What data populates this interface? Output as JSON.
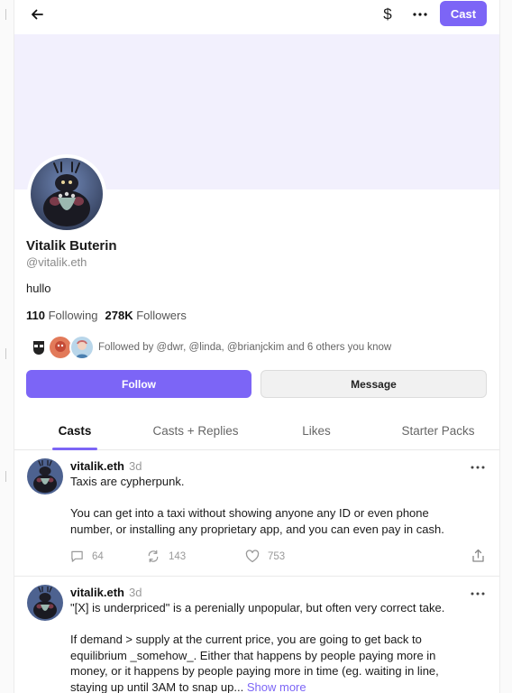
{
  "header": {
    "back_icon": "arrow-left-icon",
    "tip_symbol": "$",
    "more_icon": "more-horizontal-icon",
    "cast_button": "Cast"
  },
  "colors": {
    "accent": "#7c65f6",
    "banner": "#f2f0fd",
    "muted_text": "#8a8a8a"
  },
  "profile": {
    "name": "Vitalik Buterin",
    "handle": "@vitalik.eth",
    "bio": "hullo",
    "following_count": "110",
    "following_label": "Following",
    "followers_count": "278K",
    "followers_label": "Followers",
    "followed_by": "Followed by @dwr, @linda, @brianjckim and 6 others you know",
    "follow_button": "Follow",
    "message_button": "Message"
  },
  "tabs": [
    {
      "label": "Casts",
      "active": true
    },
    {
      "label": "Casts + Replies",
      "active": false
    },
    {
      "label": "Likes",
      "active": false
    },
    {
      "label": "Starter Packs",
      "active": false
    }
  ],
  "posts": [
    {
      "author": "vitalik.eth",
      "time": "3d",
      "paragraphs": [
        "Taxis are cypherpunk.",
        "You can get into a taxi without showing anyone any ID or even phone number, or installing any proprietary app, and you can even pay in cash."
      ],
      "replies": "64",
      "recasts": "143",
      "likes": "753"
    },
    {
      "author": "vitalik.eth",
      "time": "3d",
      "paragraphs": [
        "\"[X] is underpriced\" is a perenially unpopular, but often very correct take.",
        "If demand > supply at the current price, you are going to get back to equilibrium _somehow_. Either that happens by people paying more in money, or it happens by people paying more in time (eg. waiting in line, staying up until 3AM to snap up..."
      ],
      "show_more": "Show more"
    }
  ]
}
